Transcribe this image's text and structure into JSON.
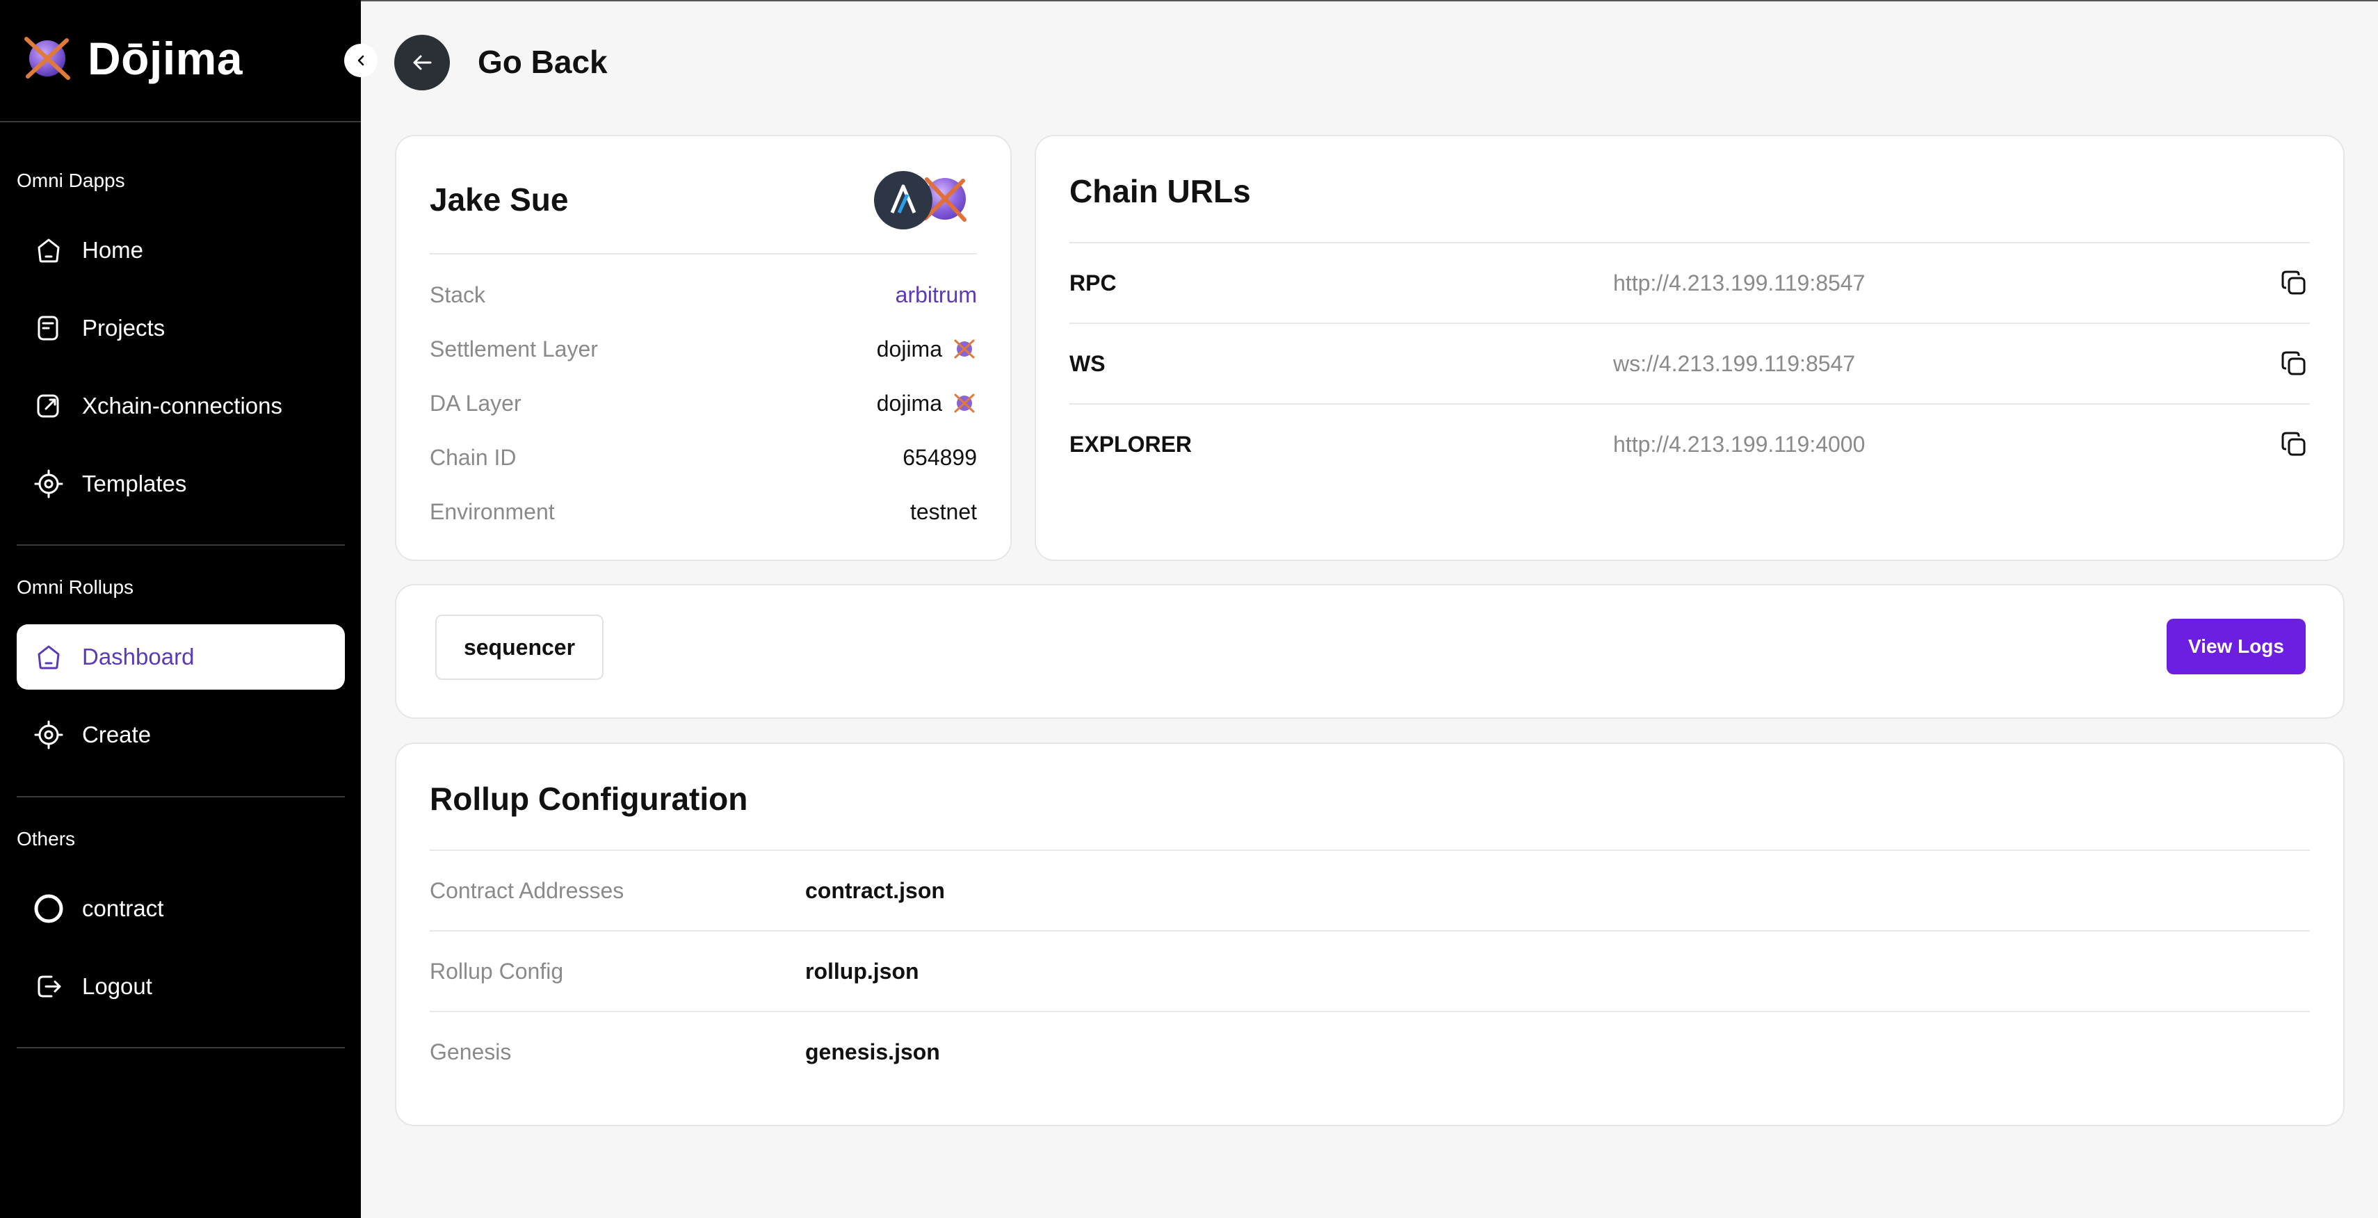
{
  "brand": {
    "name": "Dōjima"
  },
  "sidebar": {
    "sections": [
      {
        "label": "Omni Dapps"
      },
      {
        "label": "Omni Rollups"
      },
      {
        "label": "Others"
      }
    ],
    "items": [
      {
        "label": "Home",
        "icon": "home-icon"
      },
      {
        "label": "Projects",
        "icon": "document-icon"
      },
      {
        "label": "Xchain-connections",
        "icon": "edit-link-icon"
      },
      {
        "label": "Templates",
        "icon": "target-icon"
      },
      {
        "label": "Dashboard",
        "icon": "home-icon",
        "active": true
      },
      {
        "label": "Create",
        "icon": "target-icon"
      },
      {
        "label": "contract",
        "icon": "circle-icon"
      },
      {
        "label": "Logout",
        "icon": "logout-icon"
      }
    ]
  },
  "header": {
    "back_label": "Go Back"
  },
  "profile": {
    "name": "Jake Sue",
    "rows": [
      {
        "key": "Stack",
        "value": "arbitrum"
      },
      {
        "key": "Settlement Layer",
        "value": "dojima"
      },
      {
        "key": "DA Layer",
        "value": "dojima"
      },
      {
        "key": "Chain ID",
        "value": "654899"
      },
      {
        "key": "Environment",
        "value": "testnet"
      }
    ]
  },
  "chain_urls": {
    "title": "Chain URLs",
    "rows": [
      {
        "label": "RPC",
        "value": "http://4.213.199.119:8547"
      },
      {
        "label": "WS",
        "value": "ws://4.213.199.119:8547"
      },
      {
        "label": "EXPLORER",
        "value": "http://4.213.199.119:4000"
      }
    ]
  },
  "services": {
    "chip": "sequencer",
    "logs_button": "View Logs"
  },
  "rollup_config": {
    "title": "Rollup Configuration",
    "rows": [
      {
        "key": "Contract Addresses",
        "value": "contract.json"
      },
      {
        "key": "Rollup Config",
        "value": "rollup.json"
      },
      {
        "key": "Genesis",
        "value": "genesis.json"
      }
    ]
  },
  "colors": {
    "accent": "#6c1fe0",
    "link": "#5b3ab8",
    "sidebar_bg": "#000000"
  }
}
